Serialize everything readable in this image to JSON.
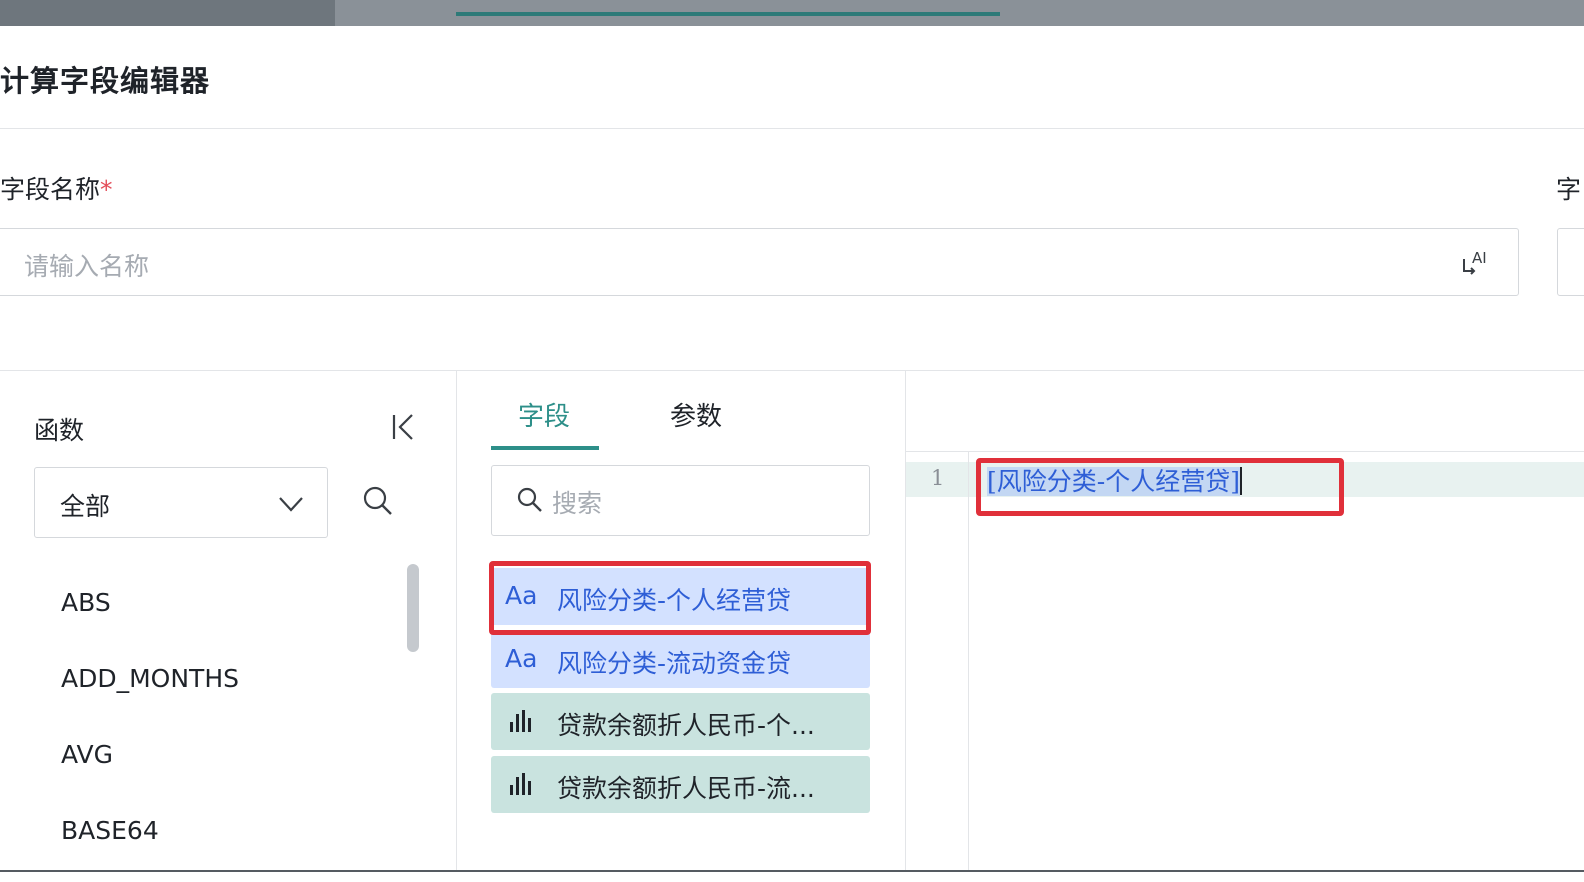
{
  "dialog": {
    "title": "计算字段编辑器"
  },
  "form": {
    "field_name_label": "字段名称",
    "required_mark": "*",
    "field_name_placeholder": "请输入名称",
    "second_label_partial": "字",
    "ai_icon": "ai-generate-icon"
  },
  "functions_panel": {
    "title": "函数",
    "category_select": {
      "selected": "全部"
    },
    "items": [
      "ABS",
      "ADD_MONTHS",
      "AVG",
      "BASE64"
    ]
  },
  "fields_panel": {
    "tabs": [
      {
        "label": "字段",
        "active": true
      },
      {
        "label": "参数",
        "active": false
      }
    ],
    "search_placeholder": "搜索",
    "items": [
      {
        "type_icon": "Aa",
        "icon_name": "text-type-icon",
        "label": "风险分类-个人经营贷",
        "kind": "dimension",
        "highlighted": true
      },
      {
        "type_icon": "Aa",
        "icon_name": "text-type-icon",
        "label": "风险分类-流动资金贷",
        "kind": "dimension",
        "highlighted": false
      },
      {
        "type_icon": "bar",
        "icon_name": "numeric-measure-icon",
        "label": "贷款余额折人民币-个...",
        "kind": "measure",
        "highlighted": false
      },
      {
        "type_icon": "bar",
        "icon_name": "numeric-measure-icon",
        "label": "贷款余额折人民币-流...",
        "kind": "measure",
        "highlighted": false
      }
    ]
  },
  "editor": {
    "line_number": "1",
    "open_bracket": "[",
    "selected_text": "风险分类-个人经营贷",
    "close_bracket": "]"
  },
  "colors": {
    "accent": "#2d8f89",
    "dimension_bg": "#d3e1ff",
    "measure_bg": "#c9e3df",
    "highlight_box": "#e0303a"
  }
}
